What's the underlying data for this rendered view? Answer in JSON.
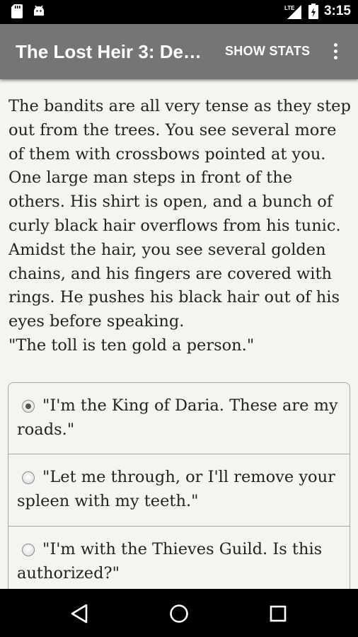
{
  "status_bar": {
    "time": "3:15",
    "network": "LTE",
    "icons": [
      "sd-card-icon",
      "android-icon",
      "lte-signal-icon",
      "battery-icon"
    ]
  },
  "app_bar": {
    "title": "The Lost Heir 3: De…",
    "show_stats_label": "SHOW STATS",
    "menu_icon": "overflow-menu-icon"
  },
  "story": {
    "paragraph": "The bandits are all very tense as they step out from the trees. You see several more of them with crossbows pointed at you. One large man steps in front of the others. His shirt is open, and a bunch of curly black hair overflows from his tunic. Amidst the hair, you see several golden chains, and his fingers are covered with rings. He pushes his black hair out of his eyes before speaking.",
    "quote": "\"The toll is ten gold a person.\""
  },
  "choices": [
    {
      "label": "\"I'm the King of Daria. These are my roads.\"",
      "selected": true
    },
    {
      "label": "\"Let me through, or I'll remove your spleen with my teeth.\"",
      "selected": false
    },
    {
      "label": "\"I'm with the Thieves Guild. Is this authorized?\"",
      "selected": false
    }
  ],
  "nav_bar": {
    "icons": [
      "back-icon",
      "home-icon",
      "recents-icon"
    ]
  },
  "colors": {
    "app_bar": "#757575",
    "content_bg": "#f6f4ef",
    "text": "#222222",
    "border": "#a9a9a9"
  }
}
